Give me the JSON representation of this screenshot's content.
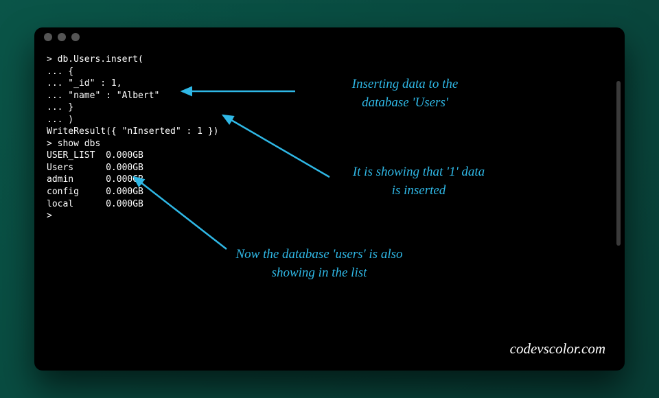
{
  "terminal": {
    "lines": [
      "> db.Users.insert(",
      "... {",
      "... \"_id\" : 1,",
      "... \"name\" : \"Albert\"",
      "... }",
      "... )",
      "WriteResult({ \"nInserted\" : 1 })",
      "> show dbs",
      "USER_LIST  0.000GB",
      "Users      0.000GB",
      "admin      0.000GB",
      "config     0.000GB",
      "local      0.000GB",
      "> "
    ]
  },
  "annotations": {
    "a1": "Inserting data to the\ndatabase 'Users'",
    "a2": "It is showing that '1' data\nis inserted",
    "a3": "Now the database 'users' is also\nshowing in the list"
  },
  "watermark": "codevscolor.com"
}
